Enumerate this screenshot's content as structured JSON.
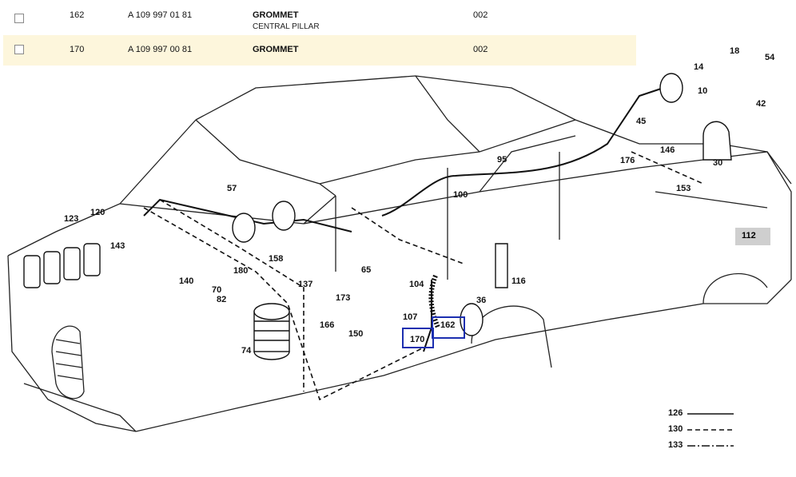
{
  "parts": [
    {
      "pos": "162",
      "part_number": "A 109 997 01 81",
      "description": "GROMMET",
      "subdescription": "CENTRAL PILLAR",
      "qty": "002"
    },
    {
      "pos": "170",
      "part_number": "A 109 997 00 81",
      "description": "GROMMET",
      "subdescription": "",
      "qty": "002"
    }
  ],
  "diagram": {
    "callouts": [
      "14",
      "18",
      "54",
      "10",
      "42",
      "45",
      "146",
      "176",
      "95",
      "30",
      "112",
      "153",
      "100",
      "57",
      "123",
      "120",
      "143",
      "158",
      "65",
      "116",
      "104",
      "36",
      "162",
      "170",
      "107",
      "150",
      "166",
      "173",
      "137",
      "180",
      "140",
      "70",
      "82",
      "74"
    ],
    "highlighted": [
      "112",
      "162",
      "170"
    ],
    "highlight_color": "#1c2fb0"
  },
  "legend": [
    {
      "label": "126",
      "style": "solid"
    },
    {
      "label": "130",
      "style": "dashed"
    },
    {
      "label": "133",
      "style": "dash-dot"
    }
  ]
}
